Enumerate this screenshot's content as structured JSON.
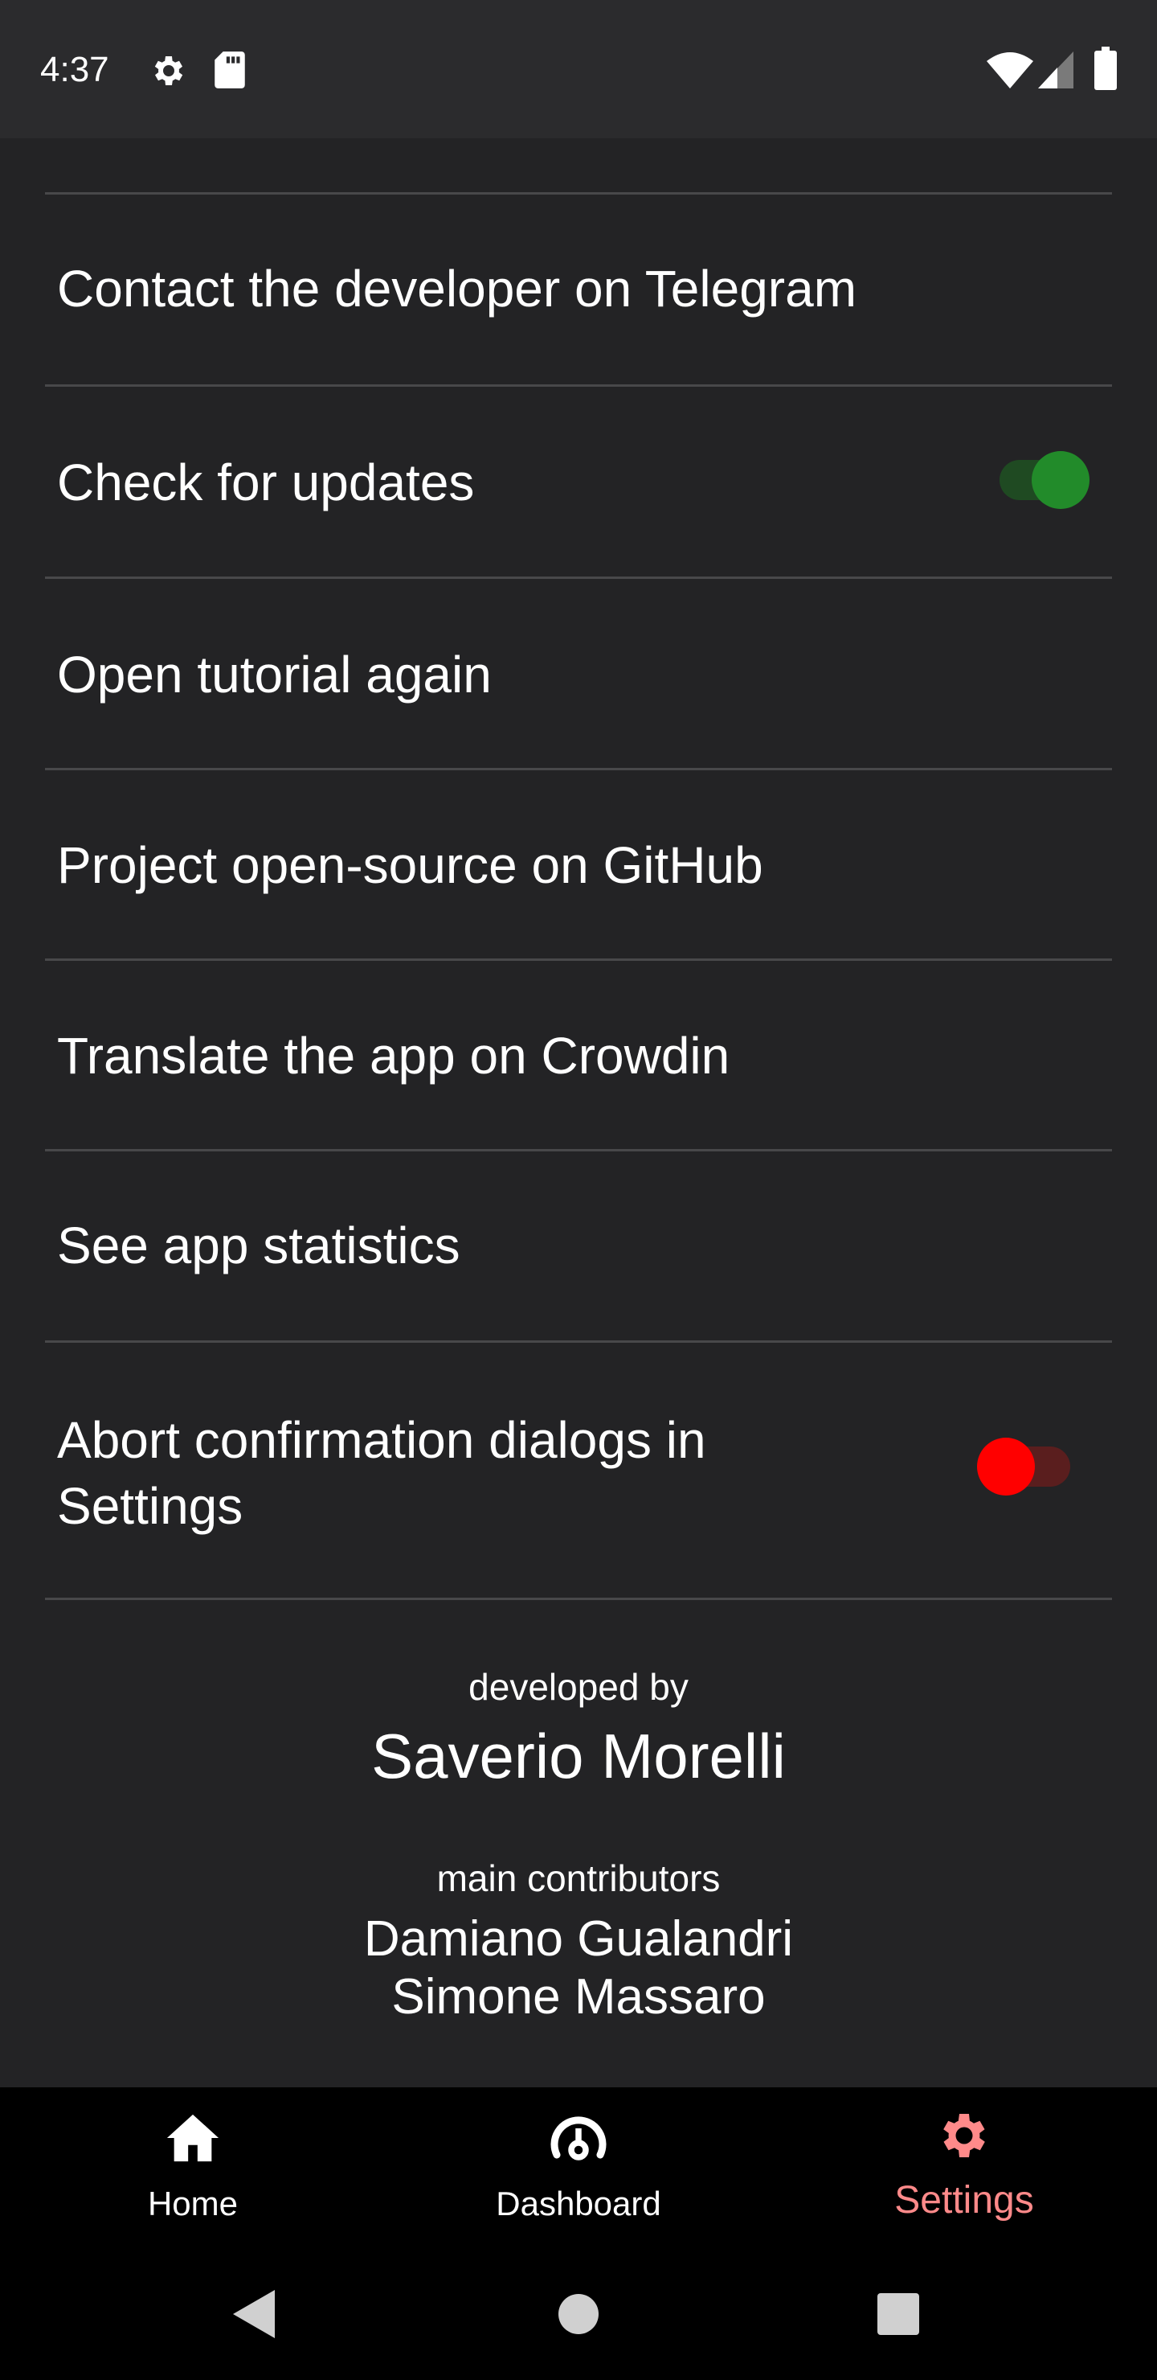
{
  "status_bar": {
    "time": "4:37",
    "icons": [
      "gear-icon",
      "sd-card-icon",
      "wifi-icon",
      "signal-icon",
      "battery-icon"
    ]
  },
  "settings": {
    "items": [
      {
        "label": "Contact the developer on Telegram",
        "has_toggle": false
      },
      {
        "label": "Check for updates",
        "has_toggle": true,
        "toggle_on": true
      },
      {
        "label": "Open tutorial again",
        "has_toggle": false
      },
      {
        "label": "Project open-source on GitHub",
        "has_toggle": false
      },
      {
        "label": "Translate the app on Crowdin",
        "has_toggle": false
      },
      {
        "label": "See app statistics",
        "has_toggle": false
      },
      {
        "label": "Abort confirmation dialogs in Settings",
        "has_toggle": true,
        "toggle_on": false
      }
    ]
  },
  "credits": {
    "developed_by_label": "developed by",
    "developer_name": "Saverio Morelli",
    "contributors_label": "main contributors",
    "contributors": [
      "Damiano Gualandri",
      "Simone Massaro"
    ]
  },
  "bottom_nav": {
    "items": [
      {
        "label": "Home",
        "icon": "home-icon",
        "active": false
      },
      {
        "label": "Dashboard",
        "icon": "dashboard-icon",
        "active": false
      },
      {
        "label": "Settings",
        "icon": "gear-icon",
        "active": true
      }
    ]
  },
  "colors": {
    "background": "#232325",
    "status_bar": "#2b2b2d",
    "divider": "#48484a",
    "toggle_on_thumb": "#228b2a",
    "toggle_on_track": "#1f4a22",
    "toggle_off_thumb": "#ff0000",
    "toggle_off_track": "#5a1e1e",
    "active_nav": "#ff8a8a",
    "nav_background": "#000000"
  }
}
